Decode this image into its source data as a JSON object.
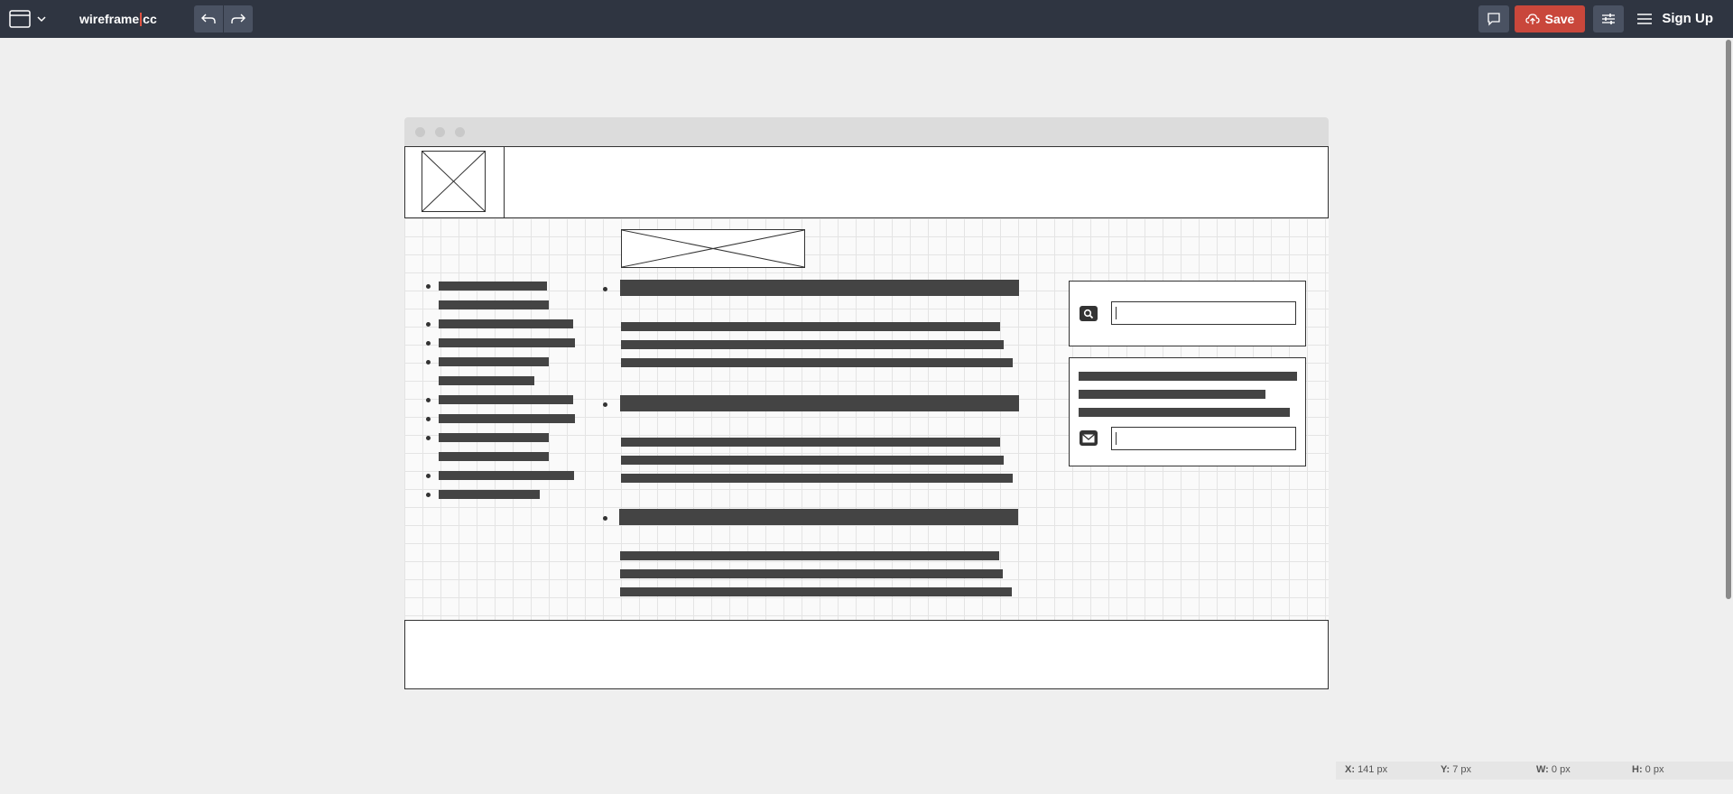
{
  "app": {
    "logo_left": "wireframe",
    "logo_right": "cc"
  },
  "toolbar": {
    "save_label": "Save",
    "signup_label": "Sign Up"
  },
  "status": {
    "x_label": "X:",
    "x_value": "141 px",
    "y_label": "Y:",
    "y_value": "7 px",
    "w_label": "W:",
    "w_value": "0 px",
    "h_label": "H:",
    "h_value": "0 px"
  },
  "icons": {
    "window": "window-icon",
    "undo": "undo-icon",
    "redo": "redo-icon",
    "comment": "comment-icon",
    "cloud": "cloud-upload-icon",
    "settings": "sliders-icon",
    "menu": "hamburger-icon",
    "search": "search-icon",
    "mail": "envelope-icon"
  },
  "colors": {
    "toolbar_bg": "#2f3541",
    "save_bg": "#c9473b",
    "accent": "#e05241"
  }
}
